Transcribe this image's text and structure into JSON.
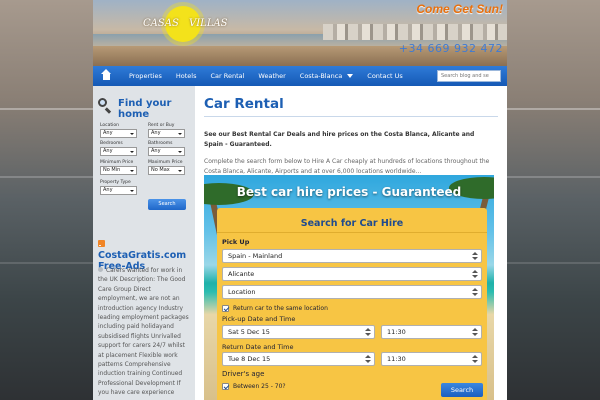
{
  "brand": {
    "logo_left": "CASAS",
    "logo_right": "VILLAS",
    "tagline": "Come Get Sun!",
    "phone": "+34 669 932 472"
  },
  "nav": {
    "items": [
      {
        "label": "Properties"
      },
      {
        "label": "Hotels"
      },
      {
        "label": "Car Rental"
      },
      {
        "label": "Weather"
      },
      {
        "label": "Costa-Blanca"
      },
      {
        "label": "Contact Us"
      }
    ],
    "search_placeholder": "Search blog and se"
  },
  "sidebar": {
    "find_title": "Find your home",
    "fields": {
      "location": {
        "label": "Location",
        "value": "Any"
      },
      "rent_buy": {
        "label": "Rent or Buy",
        "value": "Any"
      },
      "bedrooms": {
        "label": "Bedrooms",
        "value": "Any"
      },
      "bathrooms": {
        "label": "Bathrooms",
        "value": "Any"
      },
      "min_price": {
        "label": "Minimum Price",
        "value": "No Min"
      },
      "max_price": {
        "label": "Maximum Price",
        "value": "No Max"
      },
      "property_type": {
        "label": "Property Type",
        "value": "Any"
      }
    },
    "search_button": "Search",
    "rss_title": "CostaGratis.com Free-Ads",
    "rss_text": "Carers wanted for work in the UK Description: The Good Care Group   Direct employment, we are not an introduction agency Industry leading employment packages including paid holidayand subsidised flights Unrivalled support for carers 24/7 whilst at placement Flexible work patterns Comprehensive induction training Continued Professional Development If you have care experience"
  },
  "content": {
    "title": "Car Rental",
    "intro_bold": "See our Best Rental Car Deals and hire prices on the Costa Blanca, Alicante and Spain - Guaranteed.",
    "intro": "Complete the search form below to Hire A Car cheaply at hundreds of locations throughout the Costa Blanca, Alicante, Airports and at over 6,000 locations worldwide...",
    "banner_title": "Best car hire prices - Guaranteed",
    "form": {
      "title": "Search for Car Hire",
      "pickup_label": "Pick Up",
      "country": "Spain - Mainland",
      "city": "Alicante",
      "location": "Location",
      "return_same_label": "Return car to the same location",
      "pickup_datetime_label": "Pick-up Date and Time",
      "pickup_date": "Sat 5 Dec 15",
      "pickup_time": "11:30",
      "return_datetime_label": "Return Date and Time",
      "return_date": "Tue 8 Dec 15",
      "return_time": "11:30",
      "driver_age_label": "Driver's age",
      "driver_age_option": "Between 25 - 70?",
      "search_button": "Search"
    }
  }
}
